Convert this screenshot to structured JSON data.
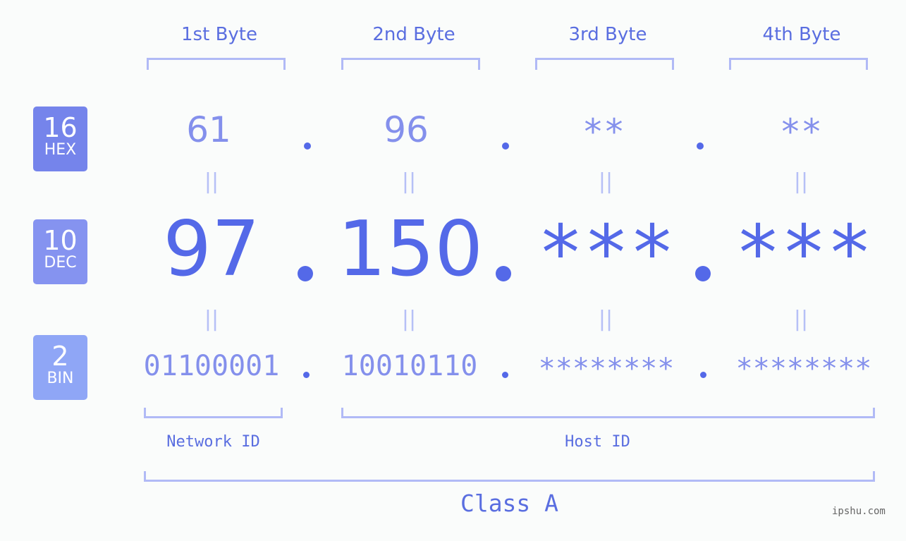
{
  "byte_headers": [
    "1st Byte",
    "2nd Byte",
    "3rd Byte",
    "4th Byte"
  ],
  "badges": [
    {
      "number": "16",
      "label": "HEX",
      "color": "#7584eb"
    },
    {
      "number": "10",
      "label": "DEC",
      "color": "#8593f0"
    },
    {
      "number": "2",
      "label": "BIN",
      "color": "#8fa6f6"
    }
  ],
  "hex": [
    "61",
    "96",
    "**",
    "**"
  ],
  "dec": [
    "97",
    "150",
    "***",
    "***"
  ],
  "bin": [
    "01100001",
    "10010110",
    "********",
    "********"
  ],
  "equals_sign": "||",
  "separator": ".",
  "network_label": "Network ID",
  "host_label": "Host ID",
  "class_label": "Class A",
  "watermark": "ipshu.com",
  "colors": {
    "primary": "#5469e8",
    "light": "#8490ec",
    "bracket": "#b1baf6",
    "background": "#fafcfb"
  }
}
